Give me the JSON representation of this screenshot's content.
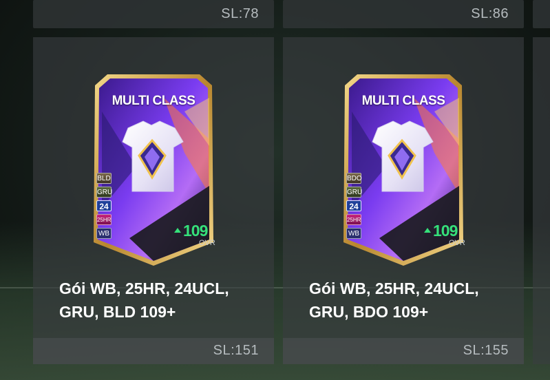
{
  "top_row": [
    {
      "sl": "SL:78"
    },
    {
      "sl": "SL:86"
    }
  ],
  "packs": [
    {
      "card_label": "MULTI CLASS",
      "badges": [
        "BLD",
        "GRU",
        "24",
        "25HR",
        "WB"
      ],
      "ovr_value": "109",
      "ovr_label": "OVR",
      "title": "Gói WB, 25HR, 24UCL, GRU, BLD 109+",
      "sl": "SL:151"
    },
    {
      "card_label": "MULTI CLASS",
      "badges": [
        "BDO",
        "GRU",
        "24",
        "25HR",
        "WB"
      ],
      "ovr_value": "109",
      "ovr_label": "OVR",
      "title": "Gói WB, 25HR, 24UCL, GRU, BDO 109+",
      "sl": "SL:155"
    }
  ],
  "colors": {
    "ovr_green": "#35e07a",
    "card_purple": "#6a2fd6",
    "card_gold": "#d9b25a"
  },
  "icons": [
    "jersey-icon",
    "multiclass-emblem-icon",
    "up-arrow-icon"
  ]
}
